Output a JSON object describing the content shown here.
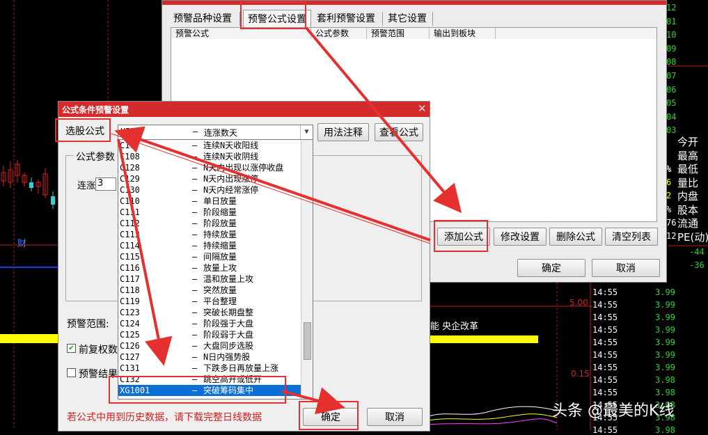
{
  "background": {
    "right_labels": [
      "今开",
      "最高",
      "最低",
      "量比",
      "内盘",
      "股本",
      "流通",
      "PE(动)"
    ],
    "right_prefix_numbers": [
      "%",
      "%",
      "6",
      "2",
      "%",
      "76",
      "12"
    ],
    "right_top_digits": [
      "12",
      "01",
      "10",
      "09",
      "08",
      "07",
      "06",
      "05",
      "04",
      "03"
    ],
    "neg_values": [
      "-44",
      "-36"
    ],
    "price_labels": [
      "5.00",
      "0.15"
    ],
    "left_marker": "财",
    "banner_text": "能 央企改革",
    "ticks": [
      {
        "time": "14:55",
        "price": "3.99"
      },
      {
        "time": "14:55",
        "price": "3.99"
      },
      {
        "time": "14:55",
        "price": "3.99"
      },
      {
        "time": "14:55",
        "price": "3.99"
      },
      {
        "time": "14:55",
        "price": "3.99"
      },
      {
        "time": "14:55",
        "price": "3.99"
      },
      {
        "time": "14:55",
        "price": "3.99"
      },
      {
        "time": "14:55",
        "price": "3.98"
      },
      {
        "time": "14:55",
        "price": "3.98"
      },
      {
        "time": "14:55",
        "price": "3.98"
      },
      {
        "time": "14:55",
        "price": "3.98"
      },
      {
        "time": "14:55",
        "price": "3.98"
      }
    ],
    "watermark": "头条 @最美的K线",
    "colors": {
      "green": "#2fd12f",
      "red": "#e02020",
      "yellow": "#ffff00",
      "blue": "#2233ff"
    }
  },
  "alert_dialog": {
    "tabs": [
      "预警品种设置",
      "预警公式设置",
      "套利预警设置",
      "其它设置"
    ],
    "columns": [
      "预警公式",
      "公式参数",
      "预警范围",
      "输出到板块"
    ],
    "buttons": {
      "add": "添加公式",
      "modify": "修改设置",
      "delete": "删除公式",
      "clear": "清空列表",
      "ok": "确定",
      "cancel": "取消"
    }
  },
  "formula_dialog": {
    "title": "公式条件预警设置",
    "select_label": "选股公式",
    "combo_value": "UPN",
    "combo_desc": "连涨数天",
    "usage_button": "用法注释",
    "view_button": "查看公式",
    "params_group": "公式参数",
    "param_label": "连涨",
    "param_value": "3",
    "range_label": "预警范围:",
    "check1_label": "前复权数",
    "check2_label": "预警结果",
    "warning": "若公式中用到历史数据，请下载完整日线数据",
    "ok_button": "确定",
    "cancel_button": "取消",
    "list": [
      {
        "code": "C107",
        "name": "连续N天收阳线"
      },
      {
        "code": "C108",
        "name": "连续N天收阴线"
      },
      {
        "code": "C128",
        "name": "N天内出现以涨停收盘"
      },
      {
        "code": "C129",
        "name": "N天内出现涨停"
      },
      {
        "code": "C130",
        "name": "N天内经常涨停"
      },
      {
        "code": "C110",
        "name": "单日放量"
      },
      {
        "code": "C111",
        "name": "阶段缩量"
      },
      {
        "code": "C112",
        "name": "阶段放量"
      },
      {
        "code": "C113",
        "name": "持续放量"
      },
      {
        "code": "C114",
        "name": "持续缩量"
      },
      {
        "code": "C115",
        "name": "间隔放量"
      },
      {
        "code": "C116",
        "name": "放量上攻"
      },
      {
        "code": "C117",
        "name": "温和放量上攻"
      },
      {
        "code": "C118",
        "name": "突然放量"
      },
      {
        "code": "C119",
        "name": "平台整理"
      },
      {
        "code": "C123",
        "name": "突破长期盘整"
      },
      {
        "code": "C124",
        "name": "阶段强于大盘"
      },
      {
        "code": "C125",
        "name": "阶段弱于大盘"
      },
      {
        "code": "C126",
        "name": "大盘同步选股"
      },
      {
        "code": "C127",
        "name": "N日内强势股"
      },
      {
        "code": "C131",
        "name": "下跌多日再放量上涨"
      },
      {
        "code": "C132",
        "name": "跳空高开或低开"
      },
      {
        "code": "XG1001",
        "name": "突破筹码集中"
      }
    ]
  }
}
